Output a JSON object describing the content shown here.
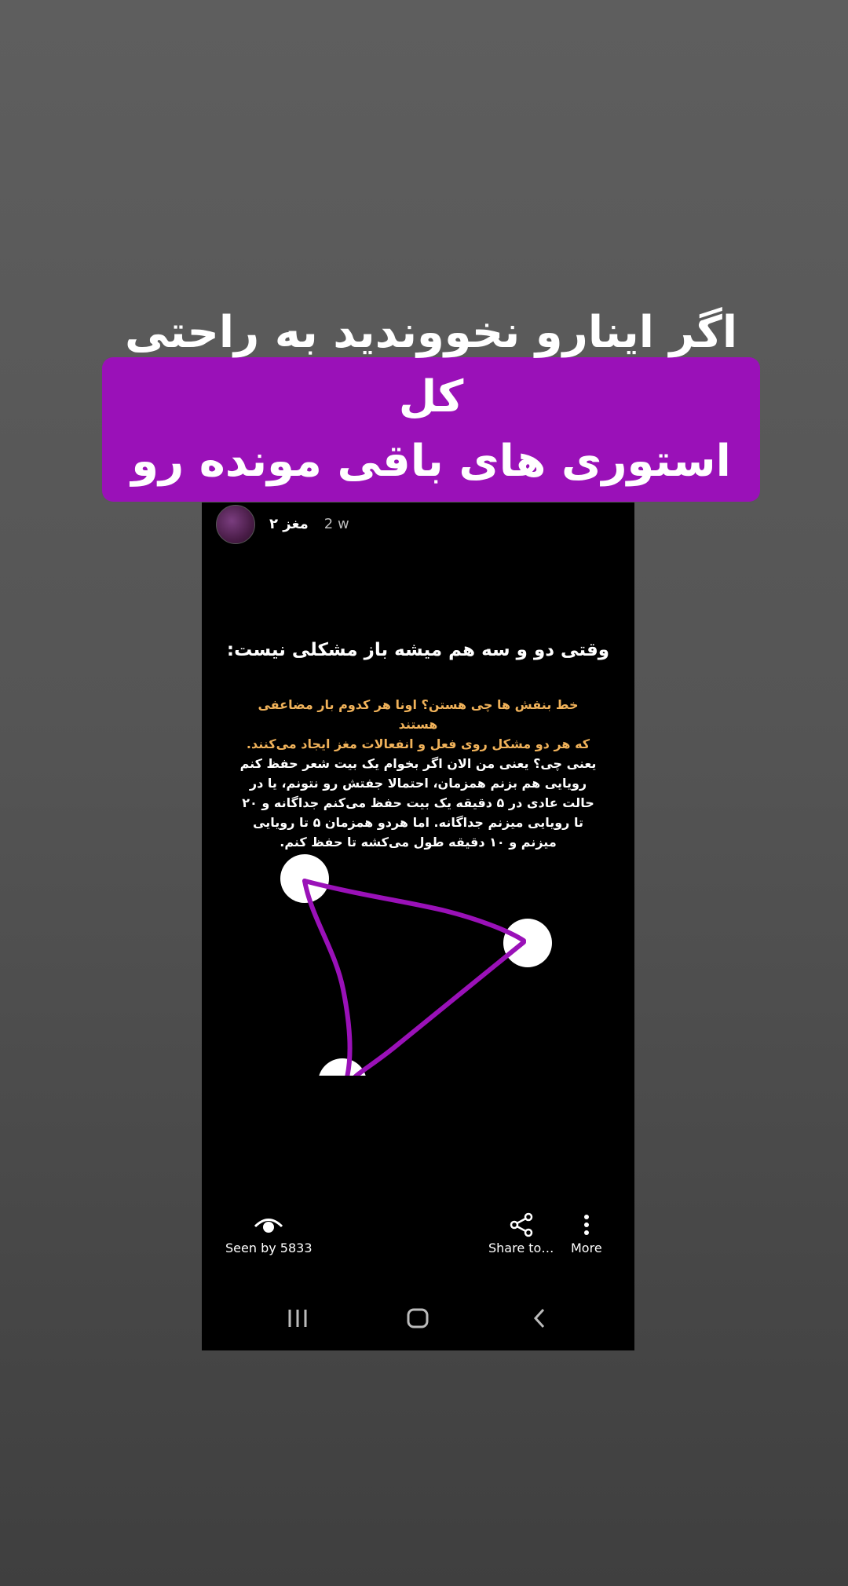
{
  "banner": {
    "line1": "اگر اینارو نخووندید به راحتی کل",
    "line2": "استوری های باقی مونده رو رد کنید"
  },
  "story": {
    "username": "مغز ۲",
    "time_ago": "2 w",
    "title": "وقتی دو و سه هم میشه باز مشکلی نیست:",
    "orange_lines": [
      "خط بنفش ها چی هستن؟ اونا هر کدوم بار مضاعفی هستند",
      "که هر دو مشکل روی فعل و انفعالات مغز ایجاد می‌کنند."
    ],
    "white_lines": [
      "یعنی چی؟ یعنی من الان اگر بخوام یک بیت شعر حفظ کنم",
      "رویایی هم بزنم همزمان، احتمالا جفتش رو نتونم، یا در",
      "حالت عادی در ۵ دقیقه یک بیت حفظ می‌کنم جداگانه و ۲۰",
      "تا رویایی میزنم جداگانه. اما هردو همزمان ۵ تا رویایی",
      "میزنم و ۱۰ دقیقه طول می‌کشه تا حفظ کنم."
    ]
  },
  "actions": {
    "seen_label": "Seen by 5833",
    "share_label": "Share to…",
    "more_label": "More"
  },
  "icons": [
    "eye-icon",
    "share-icon",
    "more-vertical-icon",
    "recent-apps-icon",
    "home-icon",
    "back-icon"
  ],
  "colors": {
    "banner": "#9a11b8",
    "line": "#9a11b8",
    "orange_text": "#f0b25a"
  }
}
